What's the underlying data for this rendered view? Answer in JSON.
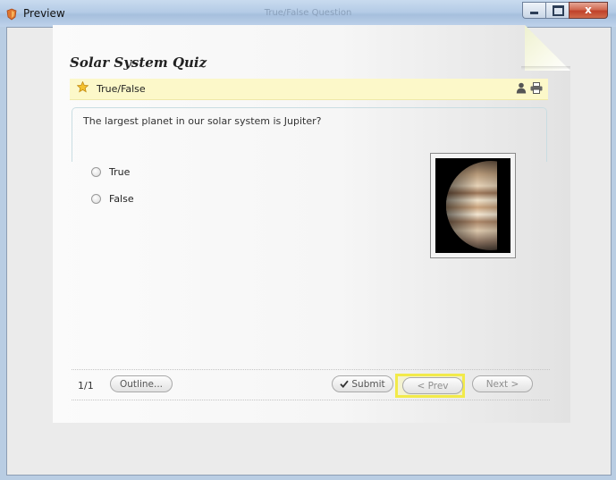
{
  "window": {
    "title": "Preview",
    "center_title": "True/False Question",
    "minimize_label": "minimize",
    "maximize_label": "maximize",
    "close_glyph": "x"
  },
  "quiz": {
    "title": "Solar System Quiz",
    "question_type": "True/False",
    "question_text": "The largest planet in our solar system is Jupiter?",
    "options": [
      {
        "label": "True",
        "selected": false
      },
      {
        "label": "False",
        "selected": false
      }
    ],
    "icons": {
      "type": "star-icon",
      "user": "user-icon",
      "print": "print-icon"
    }
  },
  "footer": {
    "page_indicator": "1/1",
    "outline_label": "Outline...",
    "submit_label": "Submit",
    "prev_label": "< Prev",
    "next_label": "Next >"
  },
  "colors": {
    "question_bar": "#fcf8c9",
    "highlight": "#f2ea4a",
    "titlebar": "#b4cbe6",
    "close_button": "#c0412a"
  }
}
